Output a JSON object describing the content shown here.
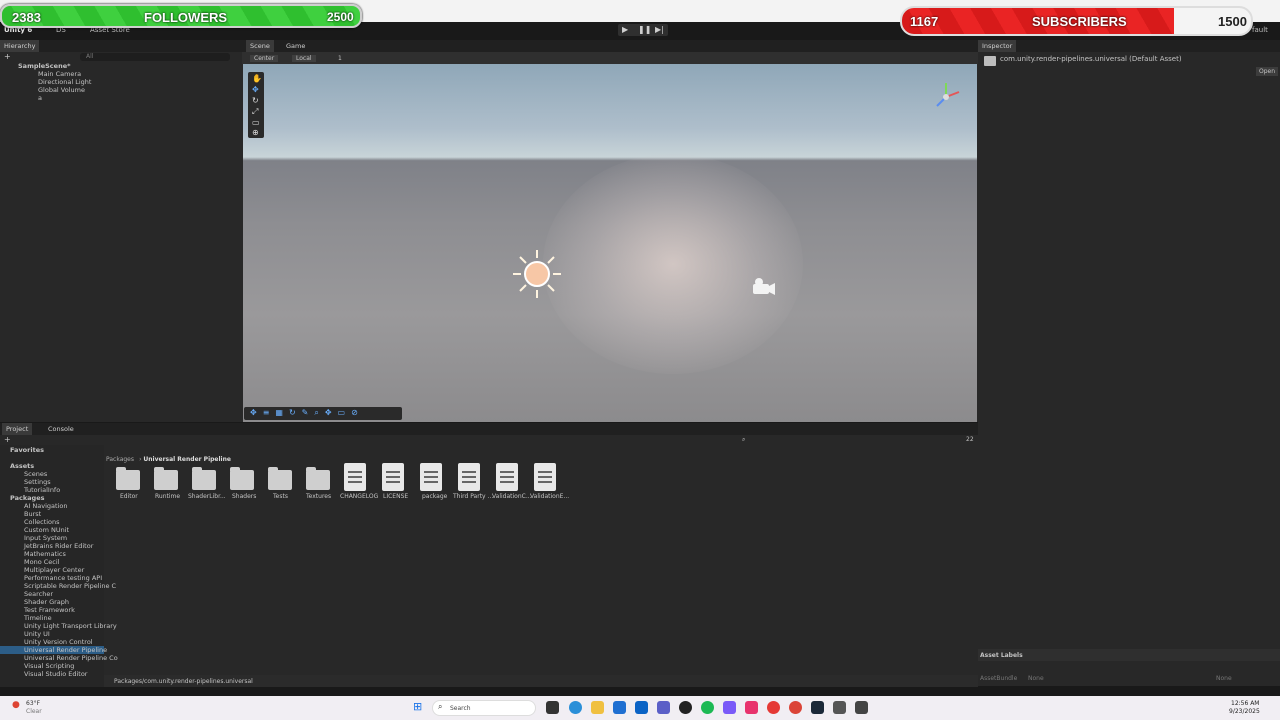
{
  "overlays": {
    "followers": {
      "current": "2383",
      "label": "FOLLOWERS",
      "goal": "2500",
      "progress": 0.95
    },
    "subscribers": {
      "current": "1167",
      "label": "SUBSCRIBERS",
      "goal": "1500",
      "progress": 0.78
    }
  },
  "toolbar": {
    "app": "Unity 6",
    "account": "DS",
    "asset_store": "Asset Store",
    "layout": "fault"
  },
  "hierarchy": {
    "tab": "Hierarchy",
    "search_placeholder": "All",
    "scene": "SampleScene*",
    "items": [
      "Main Camera",
      "Directional Light",
      "Global Volume",
      "a"
    ]
  },
  "scene": {
    "tabs": [
      "Scene",
      "Game"
    ],
    "pivot": "Center",
    "space": "Local",
    "grid_snap": "1"
  },
  "inspector": {
    "tab": "Inspector",
    "asset": "com.unity.render-pipelines.universal (Default Asset)",
    "open_button": "Open",
    "asset_labels": "Asset Labels",
    "bundle": "AssetBundle",
    "bundle_value": "None",
    "variant": "None"
  },
  "project": {
    "tabs": [
      "Project",
      "Console"
    ],
    "breadcrumb": [
      "Packages",
      "Universal Render Pipeline"
    ],
    "count": "22",
    "favorites": "Favorites",
    "assets": "Assets",
    "asset_children": [
      "Scenes",
      "Settings",
      "TutorialInfo"
    ],
    "packages": "Packages",
    "package_children": [
      "AI Navigation",
      "Burst",
      "Collections",
      "Custom NUnit",
      "Input System",
      "JetBrains Rider Editor",
      "Mathematics",
      "Mono Cecil",
      "Multiplayer Center",
      "Performance testing API",
      "Scriptable Render Pipeline C",
      "Searcher",
      "Shader Graph",
      "Test Framework",
      "Timeline",
      "Unity Light Transport Library",
      "Unity UI",
      "Unity Version Control",
      "Universal Render Pipeline",
      "Universal Render Pipeline Co",
      "Visual Scripting",
      "Visual Studio Editor"
    ],
    "folders": [
      "Editor",
      "Runtime",
      "ShaderLibr...",
      "Shaders",
      "Tests",
      "Textures"
    ],
    "files": [
      "CHANGELOG",
      "LICENSE",
      "package",
      "Third Party ...",
      "ValidationC...",
      "ValidationE..."
    ],
    "status_path": "Packages/com.unity.render-pipelines.universal"
  },
  "taskbar": {
    "weather_temp": "63°F",
    "weather_desc": "Clear",
    "search": "Search",
    "time": "12:56 AM",
    "date": "9/23/2025"
  }
}
